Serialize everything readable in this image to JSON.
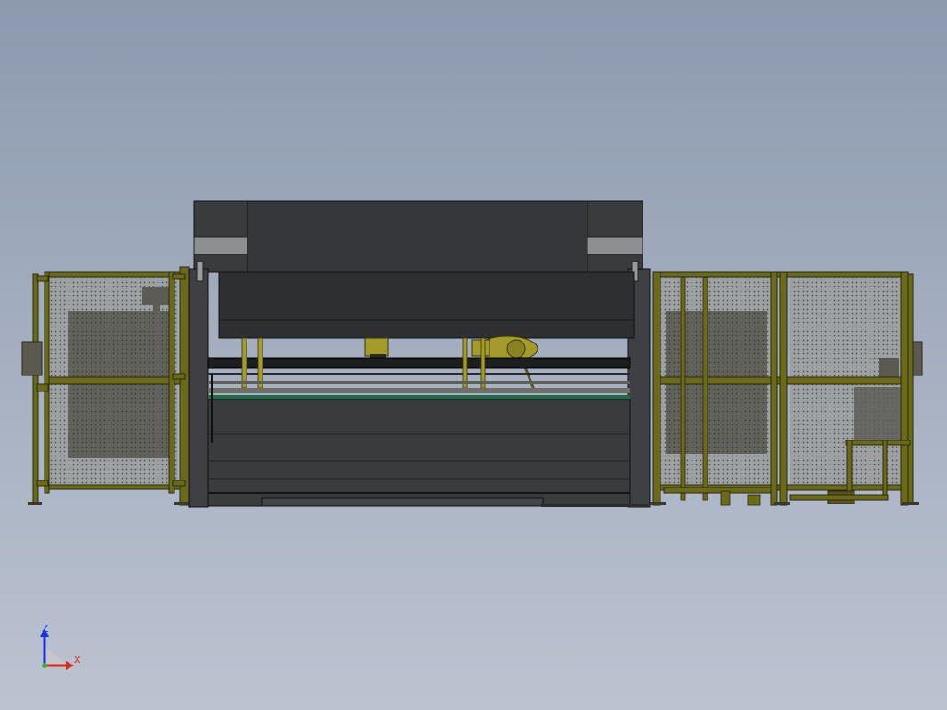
{
  "triad": {
    "z_label": "Z",
    "x_label": "X",
    "colors": {
      "z": "#1a33d6",
      "x": "#d62a1a",
      "origin": "#2fb82f"
    }
  },
  "colors": {
    "background_top": "#8c99ae",
    "background_bottom": "#bcc3d1",
    "press_body": "#3a3b3d",
    "press_ram": "#2e2f31",
    "press_highlight": "#8e8f91",
    "fence_frame": "#6b6a1a",
    "fence_mesh": "#8f8f8a",
    "panel_shade": "#5a5a52",
    "robot": "#a39b2a",
    "tool_rail": "#1e6b4a"
  },
  "icons": [
    "coordinate-triad-icon"
  ]
}
